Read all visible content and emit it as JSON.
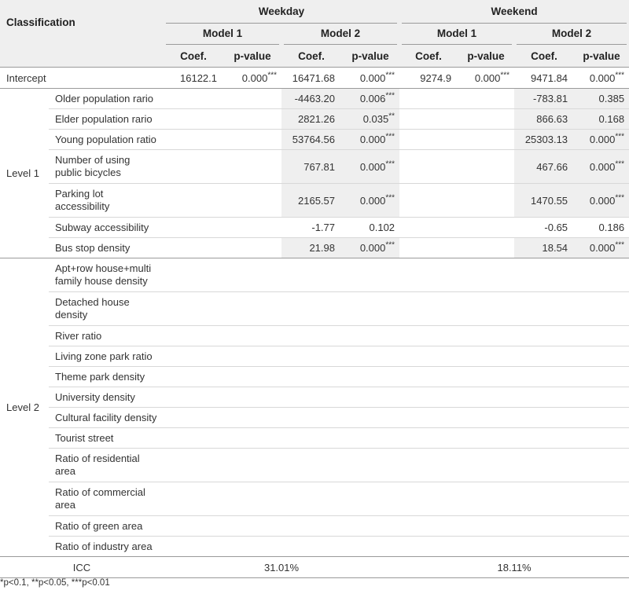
{
  "header": {
    "classification": "Classification",
    "weekday": "Weekday",
    "weekend": "Weekend",
    "model1": "Model 1",
    "model2": "Model 2",
    "coef": "Coef.",
    "pvalue": "p-value"
  },
  "intercept": {
    "label": "Intercept",
    "wd_m1_coef": "16122.1",
    "wd_m1_p": "0.000",
    "wd_m1_sig": "***",
    "wd_m2_coef": "16471.68",
    "wd_m2_p": "0.000",
    "wd_m2_sig": "***",
    "we_m1_coef": "9274.9",
    "we_m1_p": "0.000",
    "we_m1_sig": "***",
    "we_m2_coef": "9471.84",
    "we_m2_p": "0.000",
    "we_m2_sig": "***"
  },
  "level1": {
    "label": "Level 1",
    "rows": [
      {
        "name": "Older population rario",
        "wd_coef": "-4463.20",
        "wd_p": "0.006",
        "wd_sig": "***",
        "we_coef": "-783.81",
        "we_p": "0.385",
        "we_sig": ""
      },
      {
        "name": "Elder population rario",
        "wd_coef": "2821.26",
        "wd_p": "0.035",
        "wd_sig": "**",
        "we_coef": "866.63",
        "we_p": "0.168",
        "we_sig": ""
      },
      {
        "name": "Young population ratio",
        "wd_coef": "53764.56",
        "wd_p": "0.000",
        "wd_sig": "***",
        "we_coef": "25303.13",
        "we_p": "0.000",
        "we_sig": "***"
      },
      {
        "name": "Number of using\npublic bicycles",
        "wd_coef": "767.81",
        "wd_p": "0.000",
        "wd_sig": "***",
        "we_coef": "467.66",
        "we_p": "0.000",
        "we_sig": "***"
      },
      {
        "name": "Parking lot\naccessibility",
        "wd_coef": "2165.57",
        "wd_p": "0.000",
        "wd_sig": "***",
        "we_coef": "1470.55",
        "we_p": "0.000",
        "we_sig": "***"
      },
      {
        "name": "Subway accessibility",
        "wd_coef": "-1.77",
        "wd_p": "0.102",
        "wd_sig": "",
        "we_coef": "-0.65",
        "we_p": "0.186",
        "we_sig": ""
      },
      {
        "name": "Bus stop density",
        "wd_coef": "21.98",
        "wd_p": "0.000",
        "wd_sig": "***",
        "we_coef": "18.54",
        "we_p": "0.000",
        "we_sig": "***"
      }
    ]
  },
  "level2": {
    "label": "Level 2",
    "rows": [
      {
        "name": "Apt+row house+multi\nfamily house density"
      },
      {
        "name": "Detached house\ndensity"
      },
      {
        "name": "River ratio"
      },
      {
        "name": "Living zone park ratio"
      },
      {
        "name": "Theme park density"
      },
      {
        "name": "University density"
      },
      {
        "name": "Cultural facility density"
      },
      {
        "name": "Tourist street"
      },
      {
        "name": "Ratio of residential\narea"
      },
      {
        "name": "Ratio of commercial\narea"
      },
      {
        "name": "Ratio of green area"
      },
      {
        "name": "Ratio of industry area"
      }
    ]
  },
  "icc": {
    "label": "ICC",
    "weekday": "31.01%",
    "weekend": "18.11%"
  },
  "footnote": "*p<0.1, **p<0.05, ***p<0.01"
}
